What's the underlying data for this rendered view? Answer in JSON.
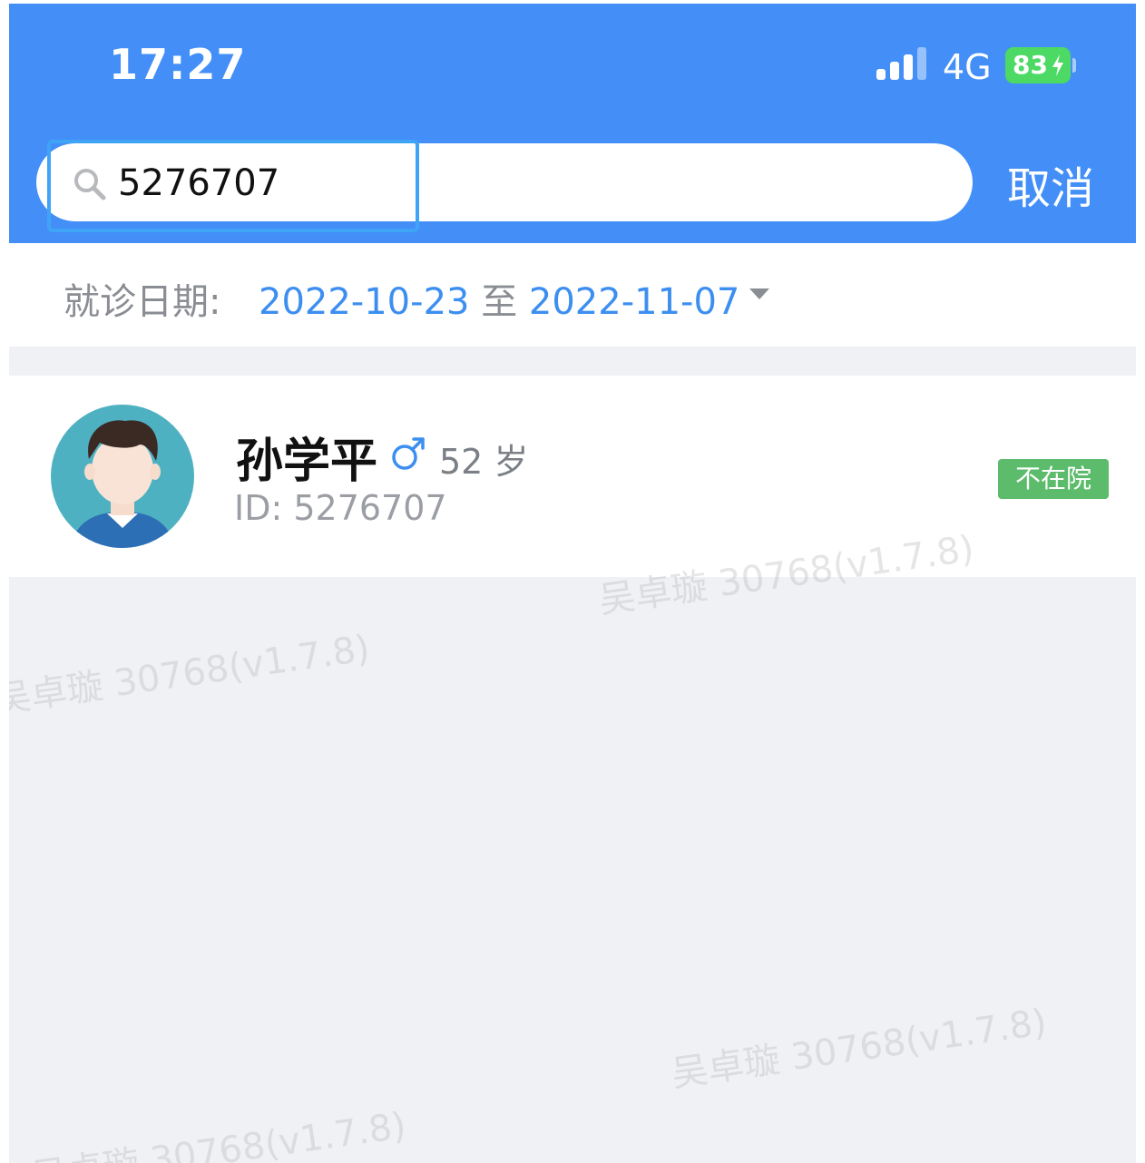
{
  "status_bar": {
    "time": "17:27",
    "network": "4G",
    "battery": "83",
    "signal_icon": "signal-bars-icon",
    "battery_icon": "battery-charging-icon"
  },
  "search": {
    "query": "5276707",
    "icon": "search-icon",
    "cancel_label": "取消"
  },
  "date_filter": {
    "label": "就诊日期:",
    "start": "2022-10-23",
    "separator": "至",
    "end": "2022-11-07",
    "dropdown_icon": "caret-down-icon"
  },
  "patients": [
    {
      "name": "孙学平",
      "gender_icon": "male-icon",
      "age": "52 岁",
      "id": "ID: 5276707",
      "status": "不在院"
    }
  ],
  "watermark": "吴卓璇 30768(v1.7.8)",
  "colors": {
    "header": "#438ff7",
    "accent": "#3c8ff0",
    "status_green": "#5cbc6b",
    "battery_green": "#4cd964",
    "background": "#f0f1f5"
  }
}
